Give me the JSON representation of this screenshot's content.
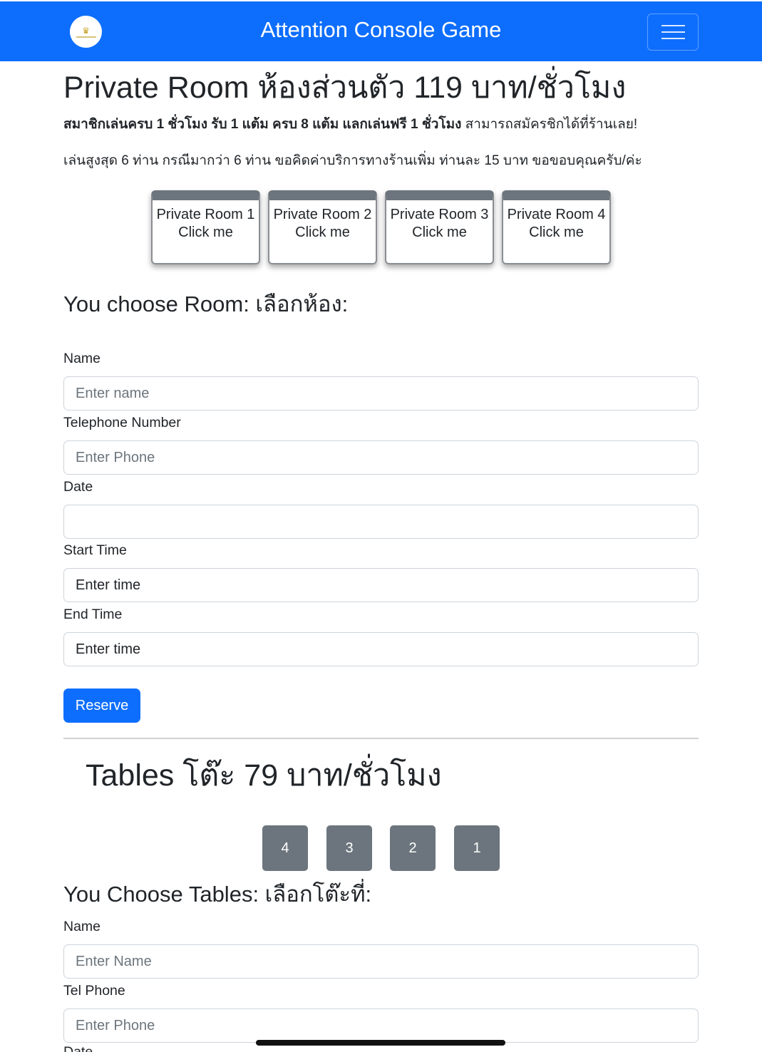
{
  "header": {
    "title": "Attention Console Game",
    "brand_color": "#0d6efd"
  },
  "rooms": {
    "heading": "Private Room ห้องส่วนตัว 119 บาท/ชั่วโมง",
    "promo_bold": "สมาชิกเล่นครบ 1 ชั่วโมง รับ 1 แต้ม ครบ 8 แต้ม แลกเล่นฟรี 1 ชั่วโมง",
    "promo_normal": " สามารถสมัครชิกได้ที่ร้านเลย!",
    "note": "เล่นสูงสุด 6 ท่าน กรณีมากว่า 6 ท่าน ขอคิดค่าบริการทางร้านเพิ่ม ท่านละ 15 บาท ขอขอบคุณครับ/ค่ะ",
    "buttons": [
      {
        "name": "Private Room 1",
        "action": "Click me"
      },
      {
        "name": "Private Room 2",
        "action": "Click me"
      },
      {
        "name": "Private Room 3",
        "action": "Click me"
      },
      {
        "name": "Private Room 4",
        "action": "Click me"
      }
    ],
    "choose_heading": "You choose Room: เลือกห้อง:"
  },
  "room_form": {
    "name_label": "Name",
    "name_placeholder": "Enter name",
    "phone_label": "Telephone Number",
    "phone_placeholder": "Enter Phone",
    "date_label": "Date",
    "date_value": "",
    "start_label": "Start Time",
    "start_placeholder": "Enter time",
    "end_label": "End Time",
    "end_placeholder": "Enter time",
    "submit_label": "Reserve"
  },
  "tables": {
    "heading": "Tables โต๊ะ 79 บาท/ชั่วโมง",
    "buttons": [
      "4",
      "3",
      "2",
      "1"
    ],
    "choose_heading": "You Choose Tables: เลือกโต๊ะที่:"
  },
  "table_form": {
    "name_label": "Name",
    "name_placeholder": "Enter Name",
    "phone_label": "Tel Phone",
    "phone_placeholder": "Enter Phone",
    "date_label": "Date"
  }
}
